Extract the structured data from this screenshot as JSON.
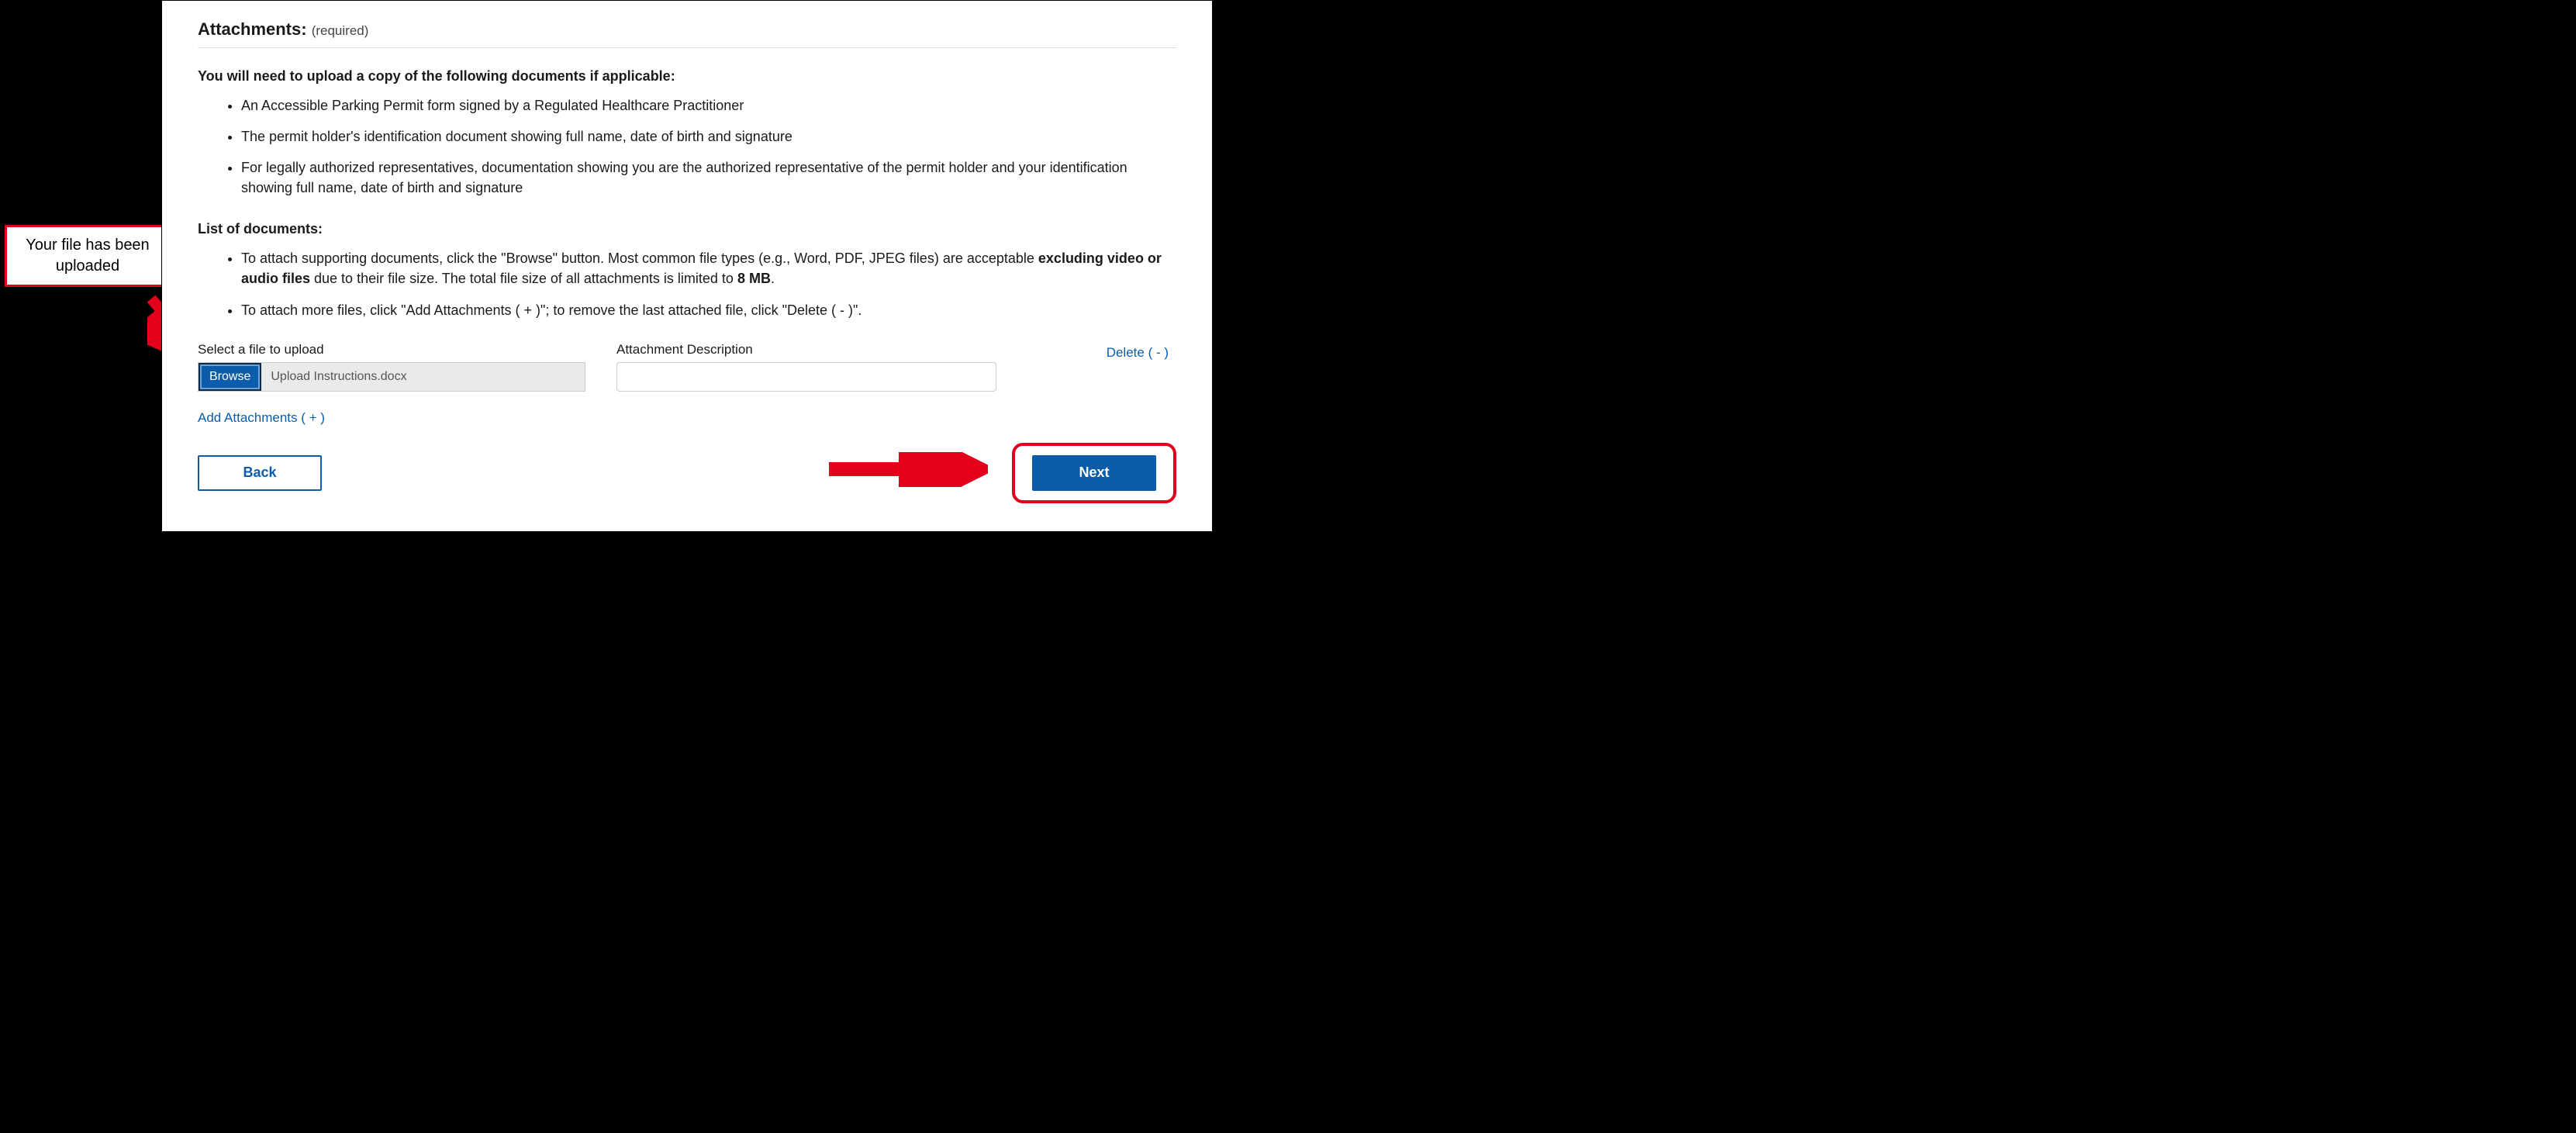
{
  "callout": {
    "text": "Your file has been uploaded"
  },
  "section": {
    "title": "Attachments:",
    "required_label": "(required)"
  },
  "intro": "You will need to upload a copy of the following documents if applicable:",
  "docs": [
    "An Accessible Parking Permit form signed by a Regulated Healthcare Practitioner",
    "The permit holder's identification document showing full name, date of birth and signature",
    "For legally authorized representatives, documentation showing you are the authorized representative of the permit holder and your identification showing full name, date of birth and signature"
  ],
  "list_heading": "List of documents:",
  "instructions": {
    "item1_pre": "To attach supporting documents, click the \"Browse\" button. Most common file types (e.g., Word, PDF, JPEG files) are acceptable ",
    "item1_bold1": "excluding video or audio files",
    "item1_mid": " due to their file size. The total file size of all attachments is limited to ",
    "item1_bold2": "8 MB",
    "item1_post": ".",
    "item2": "To attach more files, click \"Add Attachments ( + )\"; to remove the last attached file, click \"Delete ( - )\"."
  },
  "upload": {
    "file_label": "Select a file to upload",
    "browse_label": "Browse",
    "filename": "Upload Instructions.docx",
    "desc_label": "Attachment Description",
    "desc_value": "",
    "delete_label": "Delete ( - )"
  },
  "add_label": "Add Attachments ( + )",
  "nav": {
    "back": "Back",
    "next": "Next"
  },
  "colors": {
    "accent_blue": "#0b5cab",
    "annotation_red": "#e2001a"
  }
}
